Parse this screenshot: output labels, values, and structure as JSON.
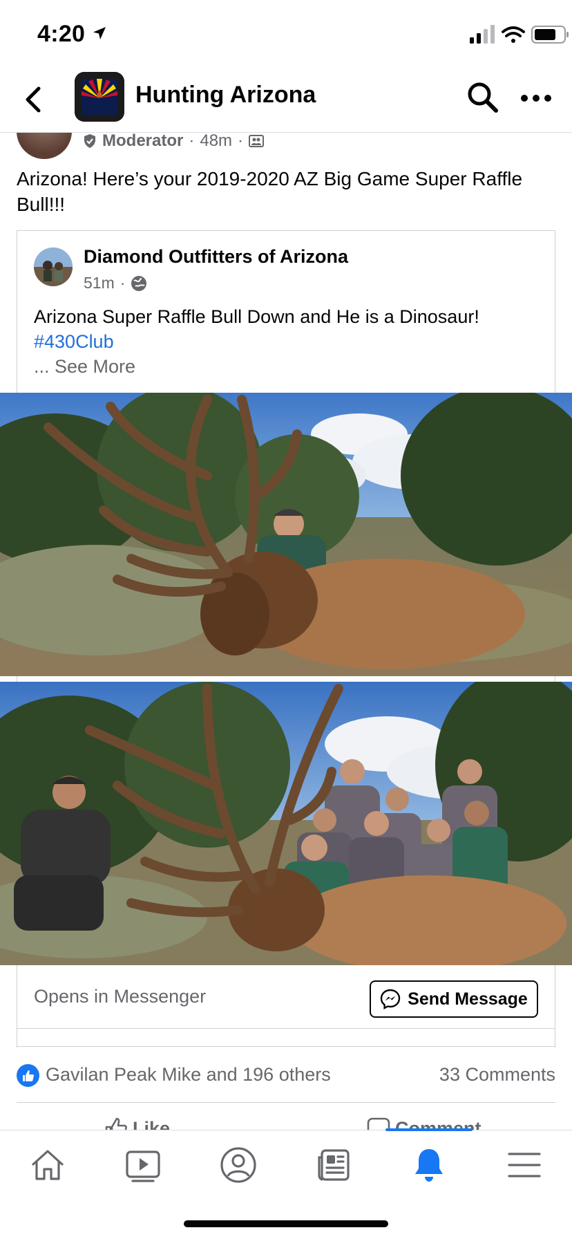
{
  "status_bar": {
    "time": "4:20"
  },
  "header": {
    "title": "Hunting Arizona"
  },
  "post": {
    "author_role": "Moderator",
    "time": "48m",
    "text": "Arizona! Here’s your 2019-2020 AZ Big Game Super Raffle Bull!!!"
  },
  "shared_post": {
    "page_name": "Diamond Outfitters of Arizona",
    "time": "51m",
    "text": "Arizona Super Raffle Bull Down and He is a Dinosaur!",
    "hashtag": "#430Club",
    "see_more": "... See More"
  },
  "messenger": {
    "label": "Opens in Messenger",
    "button_label": "Send Message"
  },
  "reactions": {
    "names": "Gavilan Peak Mike and 196 others",
    "comments": "33 Comments"
  },
  "actions": {
    "like": "Like",
    "comment": "Comment"
  },
  "tabs": [
    {
      "icon": "home-icon"
    },
    {
      "icon": "watch-icon"
    },
    {
      "icon": "profile-icon"
    },
    {
      "icon": "news-icon"
    },
    {
      "icon": "notifications-icon",
      "active": true
    },
    {
      "icon": "menu-icon"
    }
  ],
  "colors": {
    "accent": "#1877f2",
    "link": "#216fdb",
    "secondary_text": "#65676b"
  }
}
